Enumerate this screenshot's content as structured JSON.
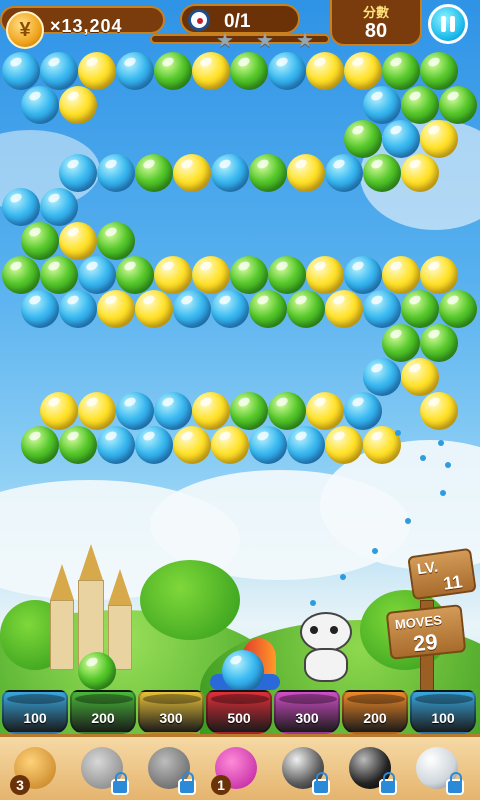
{
  "hud": {
    "coin_symbol": "¥",
    "coins": "×13,204",
    "goal_progress": "0/1",
    "progress_fraction": 0.0,
    "stars_earned": 0,
    "stars_total": 3,
    "score_label": "分數",
    "score": "80",
    "pause_icon": "pause-icon"
  },
  "level": {
    "level_text": "LV.",
    "level_number": "11",
    "moves_label": "MOVES",
    "moves": "29"
  },
  "board": {
    "rows": [
      [
        "blue",
        "blue",
        "yellow",
        "blue",
        "green",
        "yellow",
        "green",
        "blue",
        "yellow",
        "yellow",
        "green",
        "green"
      ],
      [
        "blue",
        "yellow",
        "",
        "",
        "",
        "",
        "",
        "",
        "",
        "blue",
        "green",
        "green"
      ],
      [
        "",
        "",
        "",
        "",
        "",
        "",
        "",
        "",
        "",
        "green",
        "blue",
        "yellow"
      ],
      [
        "",
        "blue",
        "blue",
        "green",
        "yellow",
        "blue",
        "green",
        "yellow",
        "blue",
        "green",
        "yellow",
        ""
      ],
      [
        "blue",
        "blue",
        "",
        "",
        "",
        "",
        "",
        "",
        "",
        "",
        "",
        ""
      ],
      [
        "green",
        "yellow",
        "green",
        "",
        "",
        "",
        "",
        "",
        "",
        "",
        "",
        ""
      ],
      [
        "green",
        "green",
        "blue",
        "green",
        "yellow",
        "yellow",
        "green",
        "green",
        "yellow",
        "blue",
        "yellow",
        "yellow"
      ],
      [
        "blue",
        "blue",
        "yellow",
        "yellow",
        "blue",
        "blue",
        "green",
        "green",
        "yellow",
        "blue",
        "green",
        "green"
      ],
      [
        "",
        "",
        "",
        "",
        "",
        "",
        "",
        "",
        "",
        "",
        "green",
        "green"
      ],
      [
        "",
        "",
        "",
        "",
        "",
        "",
        "",
        "",
        "",
        "blue",
        "yellow",
        ""
      ],
      [
        "",
        "yellow",
        "yellow",
        "blue",
        "blue",
        "yellow",
        "green",
        "green",
        "yellow",
        "blue",
        "",
        "yellow"
      ],
      [
        "green",
        "green",
        "blue",
        "blue",
        "yellow",
        "yellow",
        "blue",
        "blue",
        "yellow",
        "yellow",
        "",
        ""
      ]
    ]
  },
  "shooter": {
    "current": "blue",
    "next": "green",
    "colors": {
      "blue": "#38b8f0",
      "green": "#55c72a",
      "yellow": "#ffe22a"
    }
  },
  "pots": [
    {
      "value": "100",
      "color": "#3aa7e0"
    },
    {
      "value": "200",
      "color": "#4ab83a"
    },
    {
      "value": "300",
      "color": "#e8c23a"
    },
    {
      "value": "500",
      "color": "#e0303a"
    },
    {
      "value": "300",
      "color": "#d24fc8"
    },
    {
      "value": "200",
      "color": "#f08a2a"
    },
    {
      "value": "100",
      "color": "#3aa7e0"
    }
  ],
  "toolbar": {
    "items": [
      {
        "icon": "mallet-icon",
        "count": "3",
        "locked": false
      },
      {
        "icon": "rhino-icon",
        "locked": true
      },
      {
        "icon": "cannon-icon",
        "locked": true
      },
      {
        "icon": "guide-line-icon",
        "count": "1",
        "locked": false
      },
      {
        "icon": "steel-ball-icon",
        "locked": true
      },
      {
        "icon": "bomb-ball-icon",
        "locked": true
      },
      {
        "icon": "glass-ball-icon",
        "locked": true
      }
    ]
  }
}
